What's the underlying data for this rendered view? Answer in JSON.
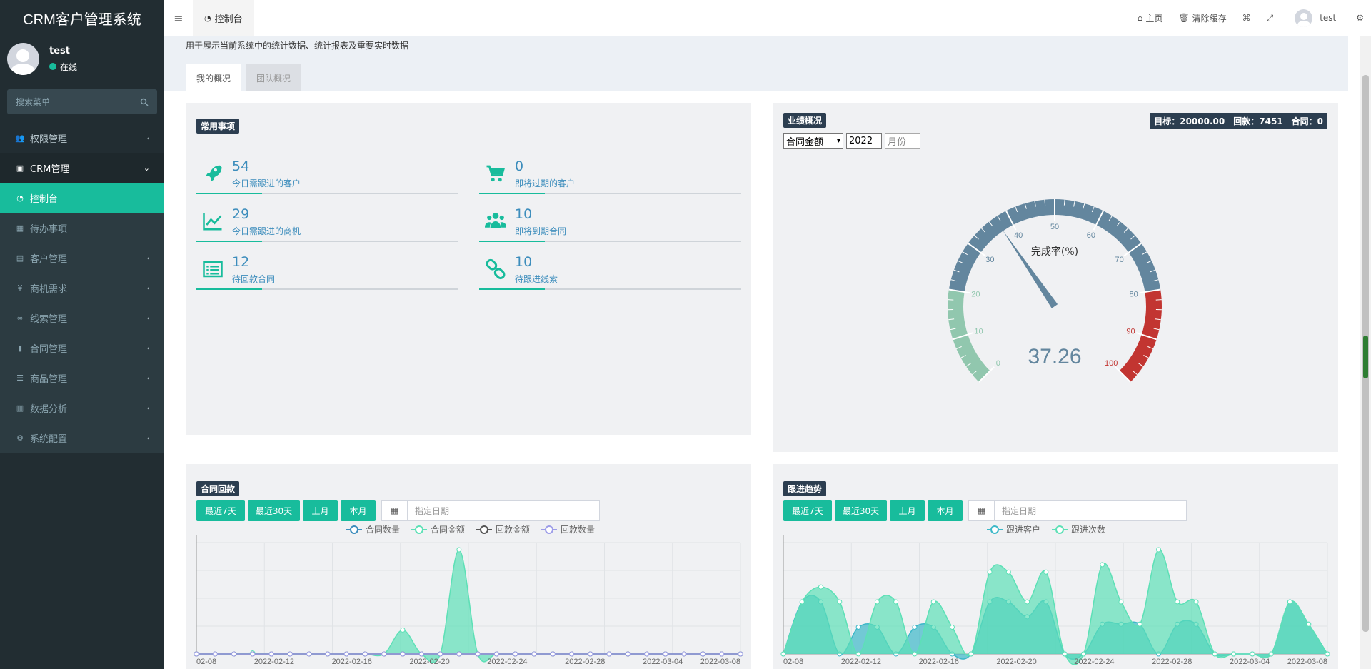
{
  "app": {
    "title": "CRM客户管理系统"
  },
  "user": {
    "name": "test",
    "status": "在线"
  },
  "sidebar": {
    "search_placeholder": "搜索菜单",
    "items": [
      {
        "label": "权限管理",
        "icon": "users-icon"
      },
      {
        "label": "CRM管理",
        "icon": "id-card-icon"
      },
      {
        "label": "控制台",
        "icon": "dashboard-icon"
      },
      {
        "label": "待办事项",
        "icon": "calendar-icon"
      },
      {
        "label": "客户管理",
        "icon": "card-icon"
      },
      {
        "label": "商机需求",
        "icon": "yen-icon"
      },
      {
        "label": "线索管理",
        "icon": "link-icon"
      },
      {
        "label": "合同管理",
        "icon": "bookmark-icon"
      },
      {
        "label": "商品管理",
        "icon": "list-icon"
      },
      {
        "label": "数据分析",
        "icon": "bar-chart-icon"
      },
      {
        "label": "系统配置",
        "icon": "cogs-icon"
      }
    ]
  },
  "header": {
    "tab_label": "控制台",
    "home": "主页",
    "clear_cache": "清除缓存",
    "username": "test"
  },
  "page": {
    "description": "用于展示当前系统中的统计数据、统计报表及重要实时数据",
    "tabs": [
      "我的概况",
      "团队概况"
    ]
  },
  "common": {
    "title": "常用事项",
    "stats": [
      {
        "value": "54",
        "label": "今日需跟进的客户",
        "icon": "rocket-icon",
        "fill": 0.25
      },
      {
        "value": "0",
        "label": "即将过期的客户",
        "icon": "cart-icon",
        "fill": 0.25
      },
      {
        "value": "29",
        "label": "今日需跟进的商机",
        "icon": "line-chart-icon",
        "fill": 0.25
      },
      {
        "value": "10",
        "label": "即将到期合同",
        "icon": "users-icon",
        "fill": 0.25
      },
      {
        "value": "12",
        "label": "待回款合同",
        "icon": "list-alt-icon",
        "fill": 0.25
      },
      {
        "value": "10",
        "label": "待跟进线索",
        "icon": "chain-icon",
        "fill": 0.25
      }
    ]
  },
  "performance": {
    "title": "业绩概况",
    "target_text": "目标：20000.00　回款：7451　合同：0",
    "select_value": "合同金额",
    "year": "2022",
    "month_placeholder": "月份"
  },
  "contract": {
    "title": "合同回款",
    "buttons": [
      "最近7天",
      "最近30天",
      "上月",
      "本月"
    ],
    "date_placeholder": "指定日期"
  },
  "followup": {
    "title": "跟进趋势",
    "buttons": [
      "最近7天",
      "最近30天",
      "上月",
      "本月"
    ],
    "date_placeholder": "指定日期"
  },
  "chart_data": [
    {
      "type": "gauge",
      "title": "完成率(%)",
      "value": 37.26,
      "min": 0,
      "max": 100,
      "ticks": [
        0,
        10,
        20,
        30,
        40,
        50,
        60,
        70,
        80,
        90,
        100
      ],
      "bands": [
        {
          "to": 20,
          "color": "#91c7ae"
        },
        {
          "to": 80,
          "color": "#63869e"
        },
        {
          "to": 100,
          "color": "#c23531"
        }
      ]
    },
    {
      "type": "area",
      "x": [
        "02-08",
        "2022-02-12",
        "2022-02-16",
        "2022-02-20",
        "2022-02-24",
        "2022-02-28",
        "2022-03-04",
        "2022-03-08"
      ],
      "series": [
        {
          "name": "合同数量",
          "color": "#3c8dbc",
          "values": [
            0,
            0,
            0,
            0,
            0,
            0,
            0,
            0,
            0,
            0,
            0,
            0,
            0,
            0,
            0,
            0,
            0,
            0,
            0,
            0,
            0,
            0,
            0,
            0,
            0,
            0,
            0,
            0,
            0,
            0
          ]
        },
        {
          "name": "合同金额",
          "color": "#5de0b6",
          "values": [
            0,
            0,
            0,
            1,
            0,
            0,
            0,
            0,
            0,
            0,
            0,
            23,
            0,
            0,
            100,
            0,
            0,
            0,
            0,
            0,
            0,
            0,
            0,
            0,
            0,
            0,
            0,
            0,
            0,
            0
          ]
        },
        {
          "name": "回款金额",
          "color": "#555555",
          "values": [
            0,
            0,
            0,
            0,
            0,
            0,
            0,
            0,
            0,
            0,
            0,
            0,
            0,
            0,
            0,
            0,
            0,
            0,
            0,
            0,
            0,
            0,
            0,
            0,
            0,
            0,
            0,
            0,
            0,
            0
          ]
        },
        {
          "name": "回款数量",
          "color": "#9d9de8",
          "values": [
            0,
            0,
            0,
            0,
            0,
            0,
            0,
            0,
            0,
            0,
            0,
            0,
            0,
            0,
            0,
            0,
            0,
            0,
            0,
            0,
            0,
            0,
            0,
            0,
            0,
            0,
            0,
            0,
            0,
            0
          ]
        }
      ]
    },
    {
      "type": "area",
      "x": [
        "02-08",
        "2022-02-12",
        "2022-02-16",
        "2022-02-20",
        "2022-02-24",
        "2022-02-28",
        "2022-03-04",
        "2022-03-08"
      ],
      "series": [
        {
          "name": "跟进客户",
          "color": "#3cb8c8",
          "values": [
            0,
            35,
            35,
            0,
            18,
            18,
            0,
            18,
            18,
            0,
            0,
            35,
            35,
            25,
            35,
            0,
            0,
            20,
            20,
            20,
            0,
            20,
            20,
            0,
            0,
            0,
            0,
            35,
            20,
            0
          ]
        },
        {
          "name": "跟进次数",
          "color": "#5de0b6",
          "values": [
            0,
            35,
            45,
            35,
            0,
            35,
            35,
            0,
            35,
            18,
            0,
            55,
            55,
            35,
            55,
            0,
            0,
            60,
            35,
            20,
            70,
            35,
            35,
            0,
            0,
            0,
            0,
            35,
            20,
            0
          ]
        }
      ]
    }
  ]
}
